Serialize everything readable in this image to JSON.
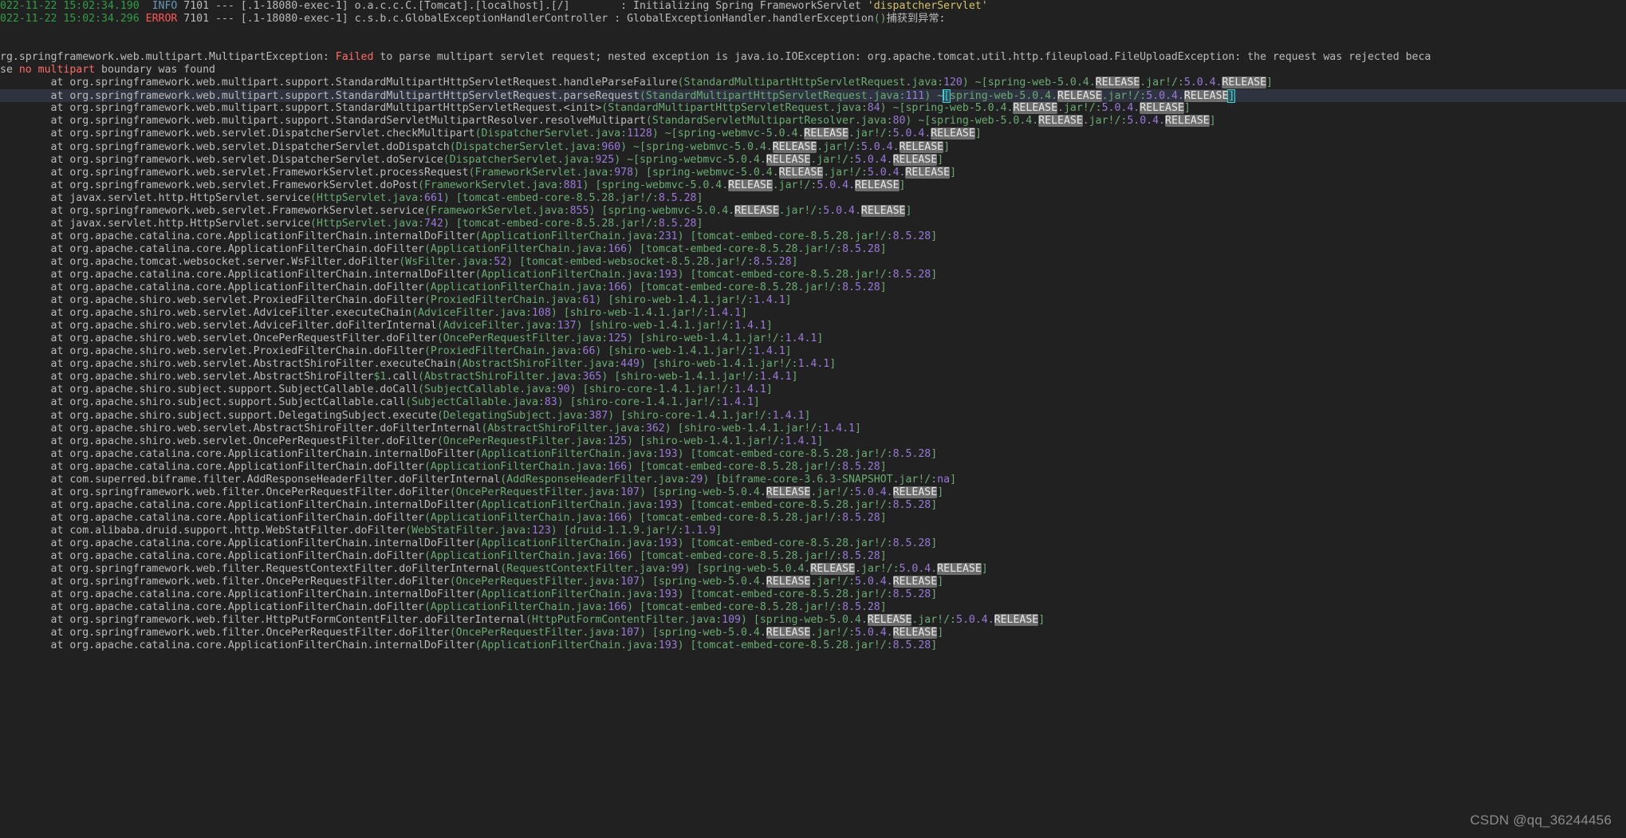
{
  "console": {
    "watermark": "CSDN @qq_36244456",
    "header_lines": [
      {
        "timestamp": "022-11-22 15:02:34.190",
        "level": "INFO",
        "pid": "7101",
        "separator": "---",
        "thread": "[.1-18080-exec-1]",
        "logger": "o.a.c.c.C.[Tomcat].[localhost].[/]",
        "pad": "        ",
        "colon": ": ",
        "message": "Initializing Spring FrameworkServlet ",
        "quoted": "'dispatcherServlet'"
      },
      {
        "timestamp": "022-11-22 15:02:34.296",
        "level": "ERROR",
        "pid": "7101",
        "separator": "---",
        "thread": "[.1-18080-exec-1]",
        "logger": "c.s.b.c.GlobalExceptionHandlerController",
        "pad": " ",
        "colon": ": ",
        "message": "GlobalExceptionHandler.handlerException",
        "parens": "()",
        "suffix": "捕获到异常:"
      }
    ],
    "exception_line": {
      "prefix": "rg.springframework.web.multipart.MultipartException: ",
      "failed": "Failed",
      "mid": " to parse multipart servlet request; nested exception is java.io.IOException: org.apache.tomcat.util.http.fileupload.FileUploadException: the request was rejected beca"
    },
    "exception_line2": {
      "prefix": "se ",
      "red": "no multipart",
      "suffix": " boundary was found"
    },
    "stack_frames": [
      {
        "cls": "org.springframework.web.multipart.support.StandardMultipartHttpServletRequest.handleParseFailure",
        "file": "StandardMultipartHttpServletRequest.java",
        "line": "120",
        "tilde": "~",
        "jar": "spring-web-5.0.4.RELEASE.jar!",
        "ver": "5.0.4.RELEASE",
        "selected": false
      },
      {
        "cls": "org.springframework.web.multipart.support.StandardMultipartHttpServletRequest.parseRequest",
        "file": "StandardMultipartHttpServletRequest.java",
        "line": "111",
        "tilde": "~",
        "jar": "spring-web-5.0.4.RELEASE.jar!",
        "ver": "5.0.4.RELEASE",
        "selected": true
      },
      {
        "cls": "org.springframework.web.multipart.support.StandardMultipartHttpServletRequest.<init>",
        "file": "StandardMultipartHttpServletRequest.java",
        "line": "84",
        "tilde": "~",
        "jar": "spring-web-5.0.4.RELEASE.jar!",
        "ver": "5.0.4.RELEASE",
        "selected": false
      },
      {
        "cls": "org.springframework.web.multipart.support.StandardServletMultipartResolver.resolveMultipart",
        "file": "StandardServletMultipartResolver.java",
        "line": "80",
        "tilde": "~",
        "jar": "spring-web-5.0.4.RELEASE.jar!",
        "ver": "5.0.4.RELEASE",
        "selected": false
      },
      {
        "cls": "org.springframework.web.servlet.DispatcherServlet.checkMultipart",
        "file": "DispatcherServlet.java",
        "line": "1128",
        "tilde": "~",
        "jar": "spring-webmvc-5.0.4.RELEASE.jar!",
        "ver": "5.0.4.RELEASE",
        "selected": false
      },
      {
        "cls": "org.springframework.web.servlet.DispatcherServlet.doDispatch",
        "file": "DispatcherServlet.java",
        "line": "960",
        "tilde": "~",
        "jar": "spring-webmvc-5.0.4.RELEASE.jar!",
        "ver": "5.0.4.RELEASE",
        "selected": false
      },
      {
        "cls": "org.springframework.web.servlet.DispatcherServlet.doService",
        "file": "DispatcherServlet.java",
        "line": "925",
        "tilde": "~",
        "jar": "spring-webmvc-5.0.4.RELEASE.jar!",
        "ver": "5.0.4.RELEASE",
        "selected": false
      },
      {
        "cls": "org.springframework.web.servlet.FrameworkServlet.processRequest",
        "file": "FrameworkServlet.java",
        "line": "978",
        "tilde": "",
        "jar": "spring-webmvc-5.0.4.RELEASE.jar!",
        "ver": "5.0.4.RELEASE",
        "selected": false
      },
      {
        "cls": "org.springframework.web.servlet.FrameworkServlet.doPost",
        "file": "FrameworkServlet.java",
        "line": "881",
        "tilde": "",
        "jar": "spring-webmvc-5.0.4.RELEASE.jar!",
        "ver": "5.0.4.RELEASE",
        "selected": false
      },
      {
        "cls": "javax.servlet.http.HttpServlet.service",
        "file": "HttpServlet.java",
        "line": "661",
        "tilde": "",
        "jar": "tomcat-embed-core-8.5.28.jar!",
        "ver": "8.5.28",
        "selected": false
      },
      {
        "cls": "org.springframework.web.servlet.FrameworkServlet.service",
        "file": "FrameworkServlet.java",
        "line": "855",
        "tilde": "",
        "jar": "spring-webmvc-5.0.4.RELEASE.jar!",
        "ver": "5.0.4.RELEASE",
        "selected": false
      },
      {
        "cls": "javax.servlet.http.HttpServlet.service",
        "file": "HttpServlet.java",
        "line": "742",
        "tilde": "",
        "jar": "tomcat-embed-core-8.5.28.jar!",
        "ver": "8.5.28",
        "selected": false
      },
      {
        "cls": "org.apache.catalina.core.ApplicationFilterChain.internalDoFilter",
        "file": "ApplicationFilterChain.java",
        "line": "231",
        "tilde": "",
        "jar": "tomcat-embed-core-8.5.28.jar!",
        "ver": "8.5.28",
        "selected": false
      },
      {
        "cls": "org.apache.catalina.core.ApplicationFilterChain.doFilter",
        "file": "ApplicationFilterChain.java",
        "line": "166",
        "tilde": "",
        "jar": "tomcat-embed-core-8.5.28.jar!",
        "ver": "8.5.28",
        "selected": false
      },
      {
        "cls": "org.apache.tomcat.websocket.server.WsFilter.doFilter",
        "file": "WsFilter.java",
        "line": "52",
        "tilde": "",
        "jar": "tomcat-embed-websocket-8.5.28.jar!",
        "ver": "8.5.28",
        "selected": false
      },
      {
        "cls": "org.apache.catalina.core.ApplicationFilterChain.internalDoFilter",
        "file": "ApplicationFilterChain.java",
        "line": "193",
        "tilde": "",
        "jar": "tomcat-embed-core-8.5.28.jar!",
        "ver": "8.5.28",
        "selected": false
      },
      {
        "cls": "org.apache.catalina.core.ApplicationFilterChain.doFilter",
        "file": "ApplicationFilterChain.java",
        "line": "166",
        "tilde": "",
        "jar": "tomcat-embed-core-8.5.28.jar!",
        "ver": "8.5.28",
        "selected": false
      },
      {
        "cls": "org.apache.shiro.web.servlet.ProxiedFilterChain.doFilter",
        "file": "ProxiedFilterChain.java",
        "line": "61",
        "tilde": "",
        "jar": "shiro-web-1.4.1.jar!",
        "ver": "1.4.1",
        "selected": false
      },
      {
        "cls": "org.apache.shiro.web.servlet.AdviceFilter.executeChain",
        "file": "AdviceFilter.java",
        "line": "108",
        "tilde": "",
        "jar": "shiro-web-1.4.1.jar!",
        "ver": "1.4.1",
        "selected": false
      },
      {
        "cls": "org.apache.shiro.web.servlet.AdviceFilter.doFilterInternal",
        "file": "AdviceFilter.java",
        "line": "137",
        "tilde": "",
        "jar": "shiro-web-1.4.1.jar!",
        "ver": "1.4.1",
        "selected": false
      },
      {
        "cls": "org.apache.shiro.web.servlet.OncePerRequestFilter.doFilter",
        "file": "OncePerRequestFilter.java",
        "line": "125",
        "tilde": "",
        "jar": "shiro-web-1.4.1.jar!",
        "ver": "1.4.1",
        "selected": false
      },
      {
        "cls": "org.apache.shiro.web.servlet.ProxiedFilterChain.doFilter",
        "file": "ProxiedFilterChain.java",
        "line": "66",
        "tilde": "",
        "jar": "shiro-web-1.4.1.jar!",
        "ver": "1.4.1",
        "selected": false
      },
      {
        "cls": "org.apache.shiro.web.servlet.AbstractShiroFilter.executeChain",
        "file": "AbstractShiroFilter.java",
        "line": "449",
        "tilde": "",
        "jar": "shiro-web-1.4.1.jar!",
        "ver": "1.4.1",
        "selected": false
      },
      {
        "cls": "org.apache.shiro.web.servlet.AbstractShiroFilter$1.call",
        "file": "AbstractShiroFilter.java",
        "line": "365",
        "tilde": "",
        "jar": "shiro-web-1.4.1.jar!",
        "ver": "1.4.1",
        "selected": false,
        "inner": "$1"
      },
      {
        "cls": "org.apache.shiro.subject.support.SubjectCallable.doCall",
        "file": "SubjectCallable.java",
        "line": "90",
        "tilde": "",
        "jar": "shiro-core-1.4.1.jar!",
        "ver": "1.4.1",
        "selected": false
      },
      {
        "cls": "org.apache.shiro.subject.support.SubjectCallable.call",
        "file": "SubjectCallable.java",
        "line": "83",
        "tilde": "",
        "jar": "shiro-core-1.4.1.jar!",
        "ver": "1.4.1",
        "selected": false
      },
      {
        "cls": "org.apache.shiro.subject.support.DelegatingSubject.execute",
        "file": "DelegatingSubject.java",
        "line": "387",
        "tilde": "",
        "jar": "shiro-core-1.4.1.jar!",
        "ver": "1.4.1",
        "selected": false
      },
      {
        "cls": "org.apache.shiro.web.servlet.AbstractShiroFilter.doFilterInternal",
        "file": "AbstractShiroFilter.java",
        "line": "362",
        "tilde": "",
        "jar": "shiro-web-1.4.1.jar!",
        "ver": "1.4.1",
        "selected": false
      },
      {
        "cls": "org.apache.shiro.web.servlet.OncePerRequestFilter.doFilter",
        "file": "OncePerRequestFilter.java",
        "line": "125",
        "tilde": "",
        "jar": "shiro-web-1.4.1.jar!",
        "ver": "1.4.1",
        "selected": false
      },
      {
        "cls": "org.apache.catalina.core.ApplicationFilterChain.internalDoFilter",
        "file": "ApplicationFilterChain.java",
        "line": "193",
        "tilde": "",
        "jar": "tomcat-embed-core-8.5.28.jar!",
        "ver": "8.5.28",
        "selected": false
      },
      {
        "cls": "org.apache.catalina.core.ApplicationFilterChain.doFilter",
        "file": "ApplicationFilterChain.java",
        "line": "166",
        "tilde": "",
        "jar": "tomcat-embed-core-8.5.28.jar!",
        "ver": "8.5.28",
        "selected": false
      },
      {
        "cls": "com.superred.biframe.filter.AddResponseHeaderFilter.doFilterInternal",
        "file": "AddResponseHeaderFilter.java",
        "line": "29",
        "tilde": "",
        "jar": "biframe-core-3.6.3-SNAPSHOT.jar!",
        "ver": "na",
        "selected": false
      },
      {
        "cls": "org.springframework.web.filter.OncePerRequestFilter.doFilter",
        "file": "OncePerRequestFilter.java",
        "line": "107",
        "tilde": "",
        "jar": "spring-web-5.0.4.RELEASE.jar!",
        "ver": "5.0.4.RELEASE",
        "selected": false
      },
      {
        "cls": "org.apache.catalina.core.ApplicationFilterChain.internalDoFilter",
        "file": "ApplicationFilterChain.java",
        "line": "193",
        "tilde": "",
        "jar": "tomcat-embed-core-8.5.28.jar!",
        "ver": "8.5.28",
        "selected": false
      },
      {
        "cls": "org.apache.catalina.core.ApplicationFilterChain.doFilter",
        "file": "ApplicationFilterChain.java",
        "line": "166",
        "tilde": "",
        "jar": "tomcat-embed-core-8.5.28.jar!",
        "ver": "8.5.28",
        "selected": false
      },
      {
        "cls": "com.alibaba.druid.support.http.WebStatFilter.doFilter",
        "file": "WebStatFilter.java",
        "line": "123",
        "tilde": "",
        "jar": "druid-1.1.9.jar!",
        "ver": "1.1.9",
        "selected": false
      },
      {
        "cls": "org.apache.catalina.core.ApplicationFilterChain.internalDoFilter",
        "file": "ApplicationFilterChain.java",
        "line": "193",
        "tilde": "",
        "jar": "tomcat-embed-core-8.5.28.jar!",
        "ver": "8.5.28",
        "selected": false
      },
      {
        "cls": "org.apache.catalina.core.ApplicationFilterChain.doFilter",
        "file": "ApplicationFilterChain.java",
        "line": "166",
        "tilde": "",
        "jar": "tomcat-embed-core-8.5.28.jar!",
        "ver": "8.5.28",
        "selected": false
      },
      {
        "cls": "org.springframework.web.filter.RequestContextFilter.doFilterInternal",
        "file": "RequestContextFilter.java",
        "line": "99",
        "tilde": "",
        "jar": "spring-web-5.0.4.RELEASE.jar!",
        "ver": "5.0.4.RELEASE",
        "selected": false
      },
      {
        "cls": "org.springframework.web.filter.OncePerRequestFilter.doFilter",
        "file": "OncePerRequestFilter.java",
        "line": "107",
        "tilde": "",
        "jar": "spring-web-5.0.4.RELEASE.jar!",
        "ver": "5.0.4.RELEASE",
        "selected": false
      },
      {
        "cls": "org.apache.catalina.core.ApplicationFilterChain.internalDoFilter",
        "file": "ApplicationFilterChain.java",
        "line": "193",
        "tilde": "",
        "jar": "tomcat-embed-core-8.5.28.jar!",
        "ver": "8.5.28",
        "selected": false
      },
      {
        "cls": "org.apache.catalina.core.ApplicationFilterChain.doFilter",
        "file": "ApplicationFilterChain.java",
        "line": "166",
        "tilde": "",
        "jar": "tomcat-embed-core-8.5.28.jar!",
        "ver": "8.5.28",
        "selected": false
      },
      {
        "cls": "org.springframework.web.filter.HttpPutFormContentFilter.doFilterInternal",
        "file": "HttpPutFormContentFilter.java",
        "line": "109",
        "tilde": "",
        "jar": "spring-web-5.0.4.RELEASE.jar!",
        "ver": "5.0.4.RELEASE",
        "selected": false
      },
      {
        "cls": "org.springframework.web.filter.OncePerRequestFilter.doFilter",
        "file": "OncePerRequestFilter.java",
        "line": "107",
        "tilde": "",
        "jar": "spring-web-5.0.4.RELEASE.jar!",
        "ver": "5.0.4.RELEASE",
        "selected": false
      },
      {
        "cls": "org.apache.catalina.core.ApplicationFilterChain.internalDoFilter",
        "file": "ApplicationFilterChain.java",
        "line": "193",
        "tilde": "",
        "jar": "tomcat-embed-core-8.5.28.jar!",
        "ver": "8.5.28",
        "selected": false
      }
    ]
  }
}
